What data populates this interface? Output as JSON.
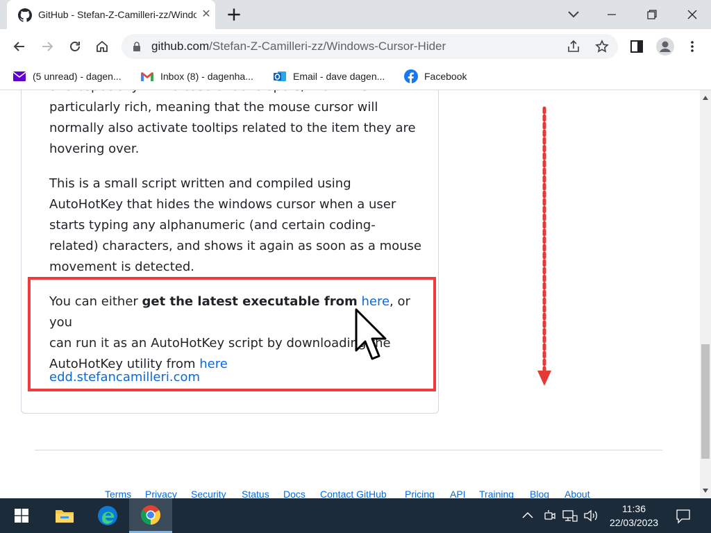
{
  "browser": {
    "tab": {
      "title": "GitHub - Stefan-Z-Camilleri-zz/Windows-Cursor-Hider",
      "close": "✕"
    },
    "url": {
      "host": "github.com",
      "path": "/Stefan-Z-Camilleri-zz/Windows-Cursor-Hider"
    },
    "bookmarks": [
      {
        "label": "(5 unread) - dagen...",
        "icon": "yahoo-mail-icon"
      },
      {
        "label": "Inbox (8) - dagenha...",
        "icon": "gmail-icon"
      },
      {
        "label": "Email - dave dagen...",
        "icon": "outlook-icon"
      },
      {
        "label": "Facebook",
        "icon": "facebook-icon"
      }
    ]
  },
  "readme": {
    "p1_lines": [
      "and especially in the case of developers, the IDE is",
      "particularly rich, meaning that the mouse cursor will",
      "normally also activate tooltips related to the item they are",
      "hovering over."
    ],
    "p2_lines": [
      "This is a small script written and compiled using",
      "AutoHotKey that hides the windows cursor when a user",
      "starts typing any alphanumeric (and certain coding-",
      "related) characters, and shows it again as soon as a mouse",
      "movement is detected."
    ],
    "p3": {
      "pre": "You can either ",
      "bold": "get the latest executable from",
      "link1": "here",
      "mid": ", or you",
      "line2": "can run it as an AutoHotKey script by downloading the",
      "line3_pre": "AutoHotKey utility from ",
      "link2": "here"
    },
    "website_link": "edd.stefancamilleri.com"
  },
  "footer": {
    "links": [
      "Terms",
      "Privacy",
      "Security",
      "Status",
      "Docs",
      "Contact GitHub",
      "Pricing",
      "API",
      "Training",
      "Blog",
      "About"
    ]
  },
  "taskbar": {
    "time": "11:36",
    "date": "22/03/2023"
  },
  "colors": {
    "link": "#0969da",
    "highlight": "#ee3b3b",
    "arrow": "#e53935"
  }
}
